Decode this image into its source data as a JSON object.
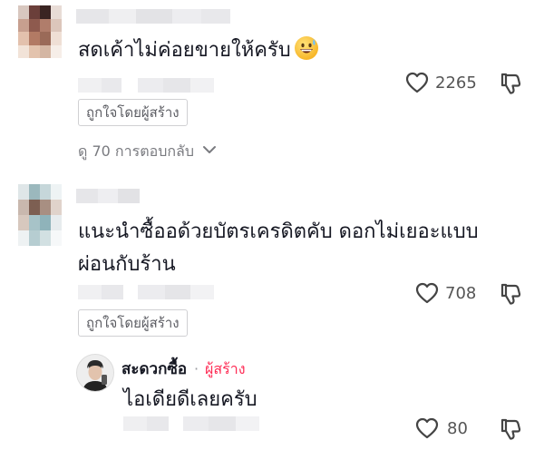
{
  "comments": [
    {
      "text_lines": [
        "สดเค้าไม่ค่อยขายให้ครับ"
      ],
      "emoji": "grinning-sweat-emoji",
      "likes": "2265",
      "creator_liked_label": "ถูกใจโดยผู้สร้าง",
      "view_replies_label": "ดู 70 การตอบกลับ"
    },
    {
      "text_lines": [
        "แนะนำซื้ออด้วยบัตรเครดิตคับ ดอกไม่เยอะแบบ",
        "ผ่อนกับร้าน"
      ],
      "likes": "708",
      "creator_liked_label": "ถูกใจโดยผู้สร้าง",
      "reply": {
        "author": "สะดวกซื้อ",
        "separator": "·",
        "creator_badge": "ผู้สร้าง",
        "text": "ไอเดียดีเลยครับ",
        "likes": "80"
      }
    }
  ],
  "icons": {
    "like": "heart-outline-icon",
    "dislike": "thumbs-down-outline-icon",
    "expand": "chevron-down-icon"
  },
  "colors": {
    "text": "#161823",
    "muted": "#7a7b80",
    "creator_accent": "#fe2c55",
    "chip_border": "#d0d0d3"
  }
}
